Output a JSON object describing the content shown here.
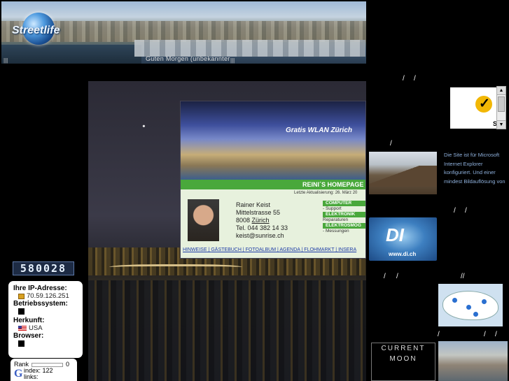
{
  "banner": {
    "brand": "Streetlife",
    "greeting": "Guten Morgen (unbekannter",
    "left_marks": "|||",
    "right_marks": "|||"
  },
  "counter": {
    "value": "580028"
  },
  "ip_box": {
    "ip_label": "Ihre IP-Adresse:",
    "ip_value": "70.59.126.251",
    "os_label": "Betriebssystem:",
    "origin_label": "Herkunft:",
    "origin_value": "USA",
    "browser_label": "Browser:"
  },
  "rank": {
    "label": "Rank",
    "value": "0",
    "index_label": "index: 122",
    "links_label": "links:"
  },
  "homepage": {
    "banner_text": "Gratis WLAN Zürich",
    "title": "REINI´S HOMEPAGE",
    "updated": "Letzte Aktualisierung: 26. März 20",
    "name": "Rainer Keist",
    "street": "Mittelstrasse 55",
    "zip": "8008",
    "city": "Zürich",
    "phone": "Tel. 044 382 14 33",
    "email": "keist@sunrise.ch",
    "menu": {
      "computer": "COMPUTER",
      "support": "- Support",
      "elektronik": "ELEKTRONIK",
      "reparaturen": "Reparaturen",
      "elektrosmog": "ELEKTROSMOG",
      "messungen": "- Messungen"
    },
    "nav": [
      "HINWEISE",
      "GÄSTEBUCH",
      "FOTOALBUM",
      "AGENDA",
      "FLOHMARKT",
      "INSERA"
    ]
  },
  "right": {
    "norton_mark": "S",
    "site_text": "Die Site ist für Microsoft Internet Explorer konfiguriert. Und einer mindest Bildauflösung von",
    "di_text": "DI",
    "di_www": "www.di.ch",
    "moon_line1": "CURRENT",
    "moon_line2": "MOON",
    "slash_1": "/",
    "slash_2": "/",
    "slash_3": "/",
    "slash_4": "/",
    "slash_5": "/",
    "slash_6": "/",
    "slash_7": "/",
    "slash_8": "//",
    "slash_9": "/",
    "slash_10": "/",
    "slash_11": "/"
  }
}
